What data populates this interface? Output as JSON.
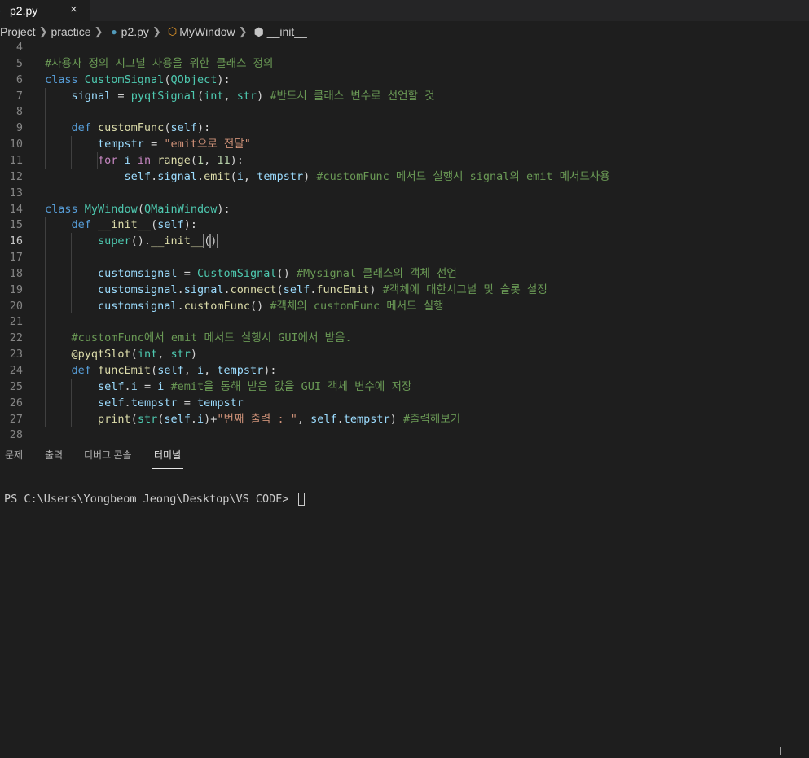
{
  "tab": {
    "filename": "p2.py",
    "close_glyph": "×"
  },
  "breadcrumb": {
    "project": "Project",
    "folder": "practice",
    "file": "p2.py",
    "class": "MyWindow",
    "method": "__init__"
  },
  "editor": {
    "active_line": "16",
    "lines": [
      {
        "n": "4",
        "tokens": []
      },
      {
        "n": "5",
        "tokens": [
          [
            "#사용자 정의 시그널 사용을 위한 클래스 정의",
            "cmt"
          ]
        ]
      },
      {
        "n": "6",
        "tokens": [
          [
            "class ",
            "kw"
          ],
          [
            "CustomSignal",
            "cls"
          ],
          [
            "(",
            "plain"
          ],
          [
            "QObject",
            "cls"
          ],
          [
            "):",
            "plain"
          ]
        ]
      },
      {
        "n": "7",
        "tokens": [
          [
            "    ",
            "plain"
          ],
          [
            "signal",
            "var"
          ],
          [
            " = ",
            "plain"
          ],
          [
            "pyqtSignal",
            "cls"
          ],
          [
            "(",
            "plain"
          ],
          [
            "int",
            "cls"
          ],
          [
            ", ",
            "plain"
          ],
          [
            "str",
            "cls"
          ],
          [
            ") ",
            "plain"
          ],
          [
            "#반드시 클래스 변수로 선언할 것",
            "cmt"
          ]
        ]
      },
      {
        "n": "8",
        "tokens": []
      },
      {
        "n": "9",
        "tokens": [
          [
            "    ",
            "plain"
          ],
          [
            "def ",
            "kw"
          ],
          [
            "customFunc",
            "fn"
          ],
          [
            "(",
            "plain"
          ],
          [
            "self",
            "var"
          ],
          [
            "):",
            "plain"
          ]
        ]
      },
      {
        "n": "10",
        "tokens": [
          [
            "        ",
            "plain"
          ],
          [
            "tempstr",
            "var"
          ],
          [
            " = ",
            "plain"
          ],
          [
            "\"emit으로 전달\"",
            "str"
          ]
        ]
      },
      {
        "n": "11",
        "tokens": [
          [
            "        ",
            "plain"
          ],
          [
            "for ",
            "ctl"
          ],
          [
            "i",
            "var"
          ],
          [
            " in ",
            "ctl"
          ],
          [
            "range",
            "fn"
          ],
          [
            "(",
            "plain"
          ],
          [
            "1",
            "num"
          ],
          [
            ", ",
            "plain"
          ],
          [
            "11",
            "num"
          ],
          [
            "):",
            "plain"
          ]
        ]
      },
      {
        "n": "12",
        "tokens": [
          [
            "            ",
            "plain"
          ],
          [
            "self",
            "var"
          ],
          [
            ".",
            "plain"
          ],
          [
            "signal",
            "var"
          ],
          [
            ".",
            "plain"
          ],
          [
            "emit",
            "fn"
          ],
          [
            "(",
            "plain"
          ],
          [
            "i",
            "var"
          ],
          [
            ", ",
            "plain"
          ],
          [
            "tempstr",
            "var"
          ],
          [
            ") ",
            "plain"
          ],
          [
            "#customFunc 메서드 실행시 signal의 emit 메서드사용",
            "cmt"
          ]
        ]
      },
      {
        "n": "13",
        "tokens": []
      },
      {
        "n": "14",
        "tokens": [
          [
            "class ",
            "kw"
          ],
          [
            "MyWindow",
            "cls"
          ],
          [
            "(",
            "plain"
          ],
          [
            "QMainWindow",
            "cls"
          ],
          [
            "):",
            "plain"
          ]
        ]
      },
      {
        "n": "15",
        "tokens": [
          [
            "    ",
            "plain"
          ],
          [
            "def ",
            "kw"
          ],
          [
            "__init__",
            "fn"
          ],
          [
            "(",
            "plain"
          ],
          [
            "self",
            "var"
          ],
          [
            "):",
            "plain"
          ]
        ]
      },
      {
        "n": "16",
        "tokens": [
          [
            "        ",
            "plain"
          ],
          [
            "super",
            "cls"
          ],
          [
            "().",
            "plain"
          ],
          [
            "__init__",
            "fn"
          ],
          [
            "(",
            "brk"
          ],
          [
            ")",
            "brk"
          ]
        ]
      },
      {
        "n": "17",
        "tokens": []
      },
      {
        "n": "18",
        "tokens": [
          [
            "        ",
            "plain"
          ],
          [
            "customsignal",
            "var"
          ],
          [
            " = ",
            "plain"
          ],
          [
            "CustomSignal",
            "cls"
          ],
          [
            "() ",
            "plain"
          ],
          [
            "#Mysignal 클래스의 객체 선언",
            "cmt"
          ]
        ]
      },
      {
        "n": "19",
        "tokens": [
          [
            "        ",
            "plain"
          ],
          [
            "customsignal",
            "var"
          ],
          [
            ".",
            "plain"
          ],
          [
            "signal",
            "var"
          ],
          [
            ".",
            "plain"
          ],
          [
            "connect",
            "fn"
          ],
          [
            "(",
            "plain"
          ],
          [
            "self",
            "var"
          ],
          [
            ".",
            "plain"
          ],
          [
            "funcEmit",
            "fn"
          ],
          [
            ") ",
            "plain"
          ],
          [
            "#객체에 대한시그널 및 슬롯 설정",
            "cmt"
          ]
        ]
      },
      {
        "n": "20",
        "tokens": [
          [
            "        ",
            "plain"
          ],
          [
            "customsignal",
            "var"
          ],
          [
            ".",
            "plain"
          ],
          [
            "customFunc",
            "fn"
          ],
          [
            "() ",
            "plain"
          ],
          [
            "#객체의 customFunc 메서드 실행",
            "cmt"
          ]
        ]
      },
      {
        "n": "21",
        "tokens": []
      },
      {
        "n": "22",
        "tokens": [
          [
            "    ",
            "plain"
          ],
          [
            "#customFunc에서 emit 메서드 실행시 GUI에서 받음.",
            "cmt"
          ]
        ]
      },
      {
        "n": "23",
        "tokens": [
          [
            "    ",
            "plain"
          ],
          [
            "@pyqtSlot",
            "fn"
          ],
          [
            "(",
            "plain"
          ],
          [
            "int",
            "cls"
          ],
          [
            ", ",
            "plain"
          ],
          [
            "str",
            "cls"
          ],
          [
            ")",
            "plain"
          ]
        ]
      },
      {
        "n": "24",
        "tokens": [
          [
            "    ",
            "plain"
          ],
          [
            "def ",
            "kw"
          ],
          [
            "funcEmit",
            "fn"
          ],
          [
            "(",
            "plain"
          ],
          [
            "self",
            "var"
          ],
          [
            ", ",
            "plain"
          ],
          [
            "i",
            "var"
          ],
          [
            ", ",
            "plain"
          ],
          [
            "tempstr",
            "var"
          ],
          [
            "):",
            "plain"
          ]
        ]
      },
      {
        "n": "25",
        "tokens": [
          [
            "        ",
            "plain"
          ],
          [
            "self",
            "var"
          ],
          [
            ".",
            "plain"
          ],
          [
            "i",
            "var"
          ],
          [
            " = ",
            "plain"
          ],
          [
            "i",
            "var"
          ],
          [
            " ",
            "plain"
          ],
          [
            "#emit을 통해 받은 값을 GUI 객체 변수에 저장",
            "cmt"
          ]
        ]
      },
      {
        "n": "26",
        "tokens": [
          [
            "        ",
            "plain"
          ],
          [
            "self",
            "var"
          ],
          [
            ".",
            "plain"
          ],
          [
            "tempstr",
            "var"
          ],
          [
            " = ",
            "plain"
          ],
          [
            "tempstr",
            "var"
          ]
        ]
      },
      {
        "n": "27",
        "tokens": [
          [
            "        ",
            "plain"
          ],
          [
            "print",
            "fn"
          ],
          [
            "(",
            "plain"
          ],
          [
            "str",
            "cls"
          ],
          [
            "(",
            "plain"
          ],
          [
            "self",
            "var"
          ],
          [
            ".",
            "plain"
          ],
          [
            "i",
            "var"
          ],
          [
            ")+",
            "plain"
          ],
          [
            "\"번째 출력 : \"",
            "str"
          ],
          [
            ", ",
            "plain"
          ],
          [
            "self",
            "var"
          ],
          [
            ".",
            "plain"
          ],
          [
            "tempstr",
            "var"
          ],
          [
            ") ",
            "plain"
          ],
          [
            "#출력해보기",
            "cmt"
          ]
        ]
      },
      {
        "n": "28",
        "tokens": []
      }
    ]
  },
  "panel": {
    "tabs": [
      "문제",
      "출력",
      "디버그 콘솔",
      "터미널"
    ],
    "active_tab": "터미널"
  },
  "terminal": {
    "prompt": "PS C:\\Users\\Yongbeom Jeong\\Desktop\\VS CODE> "
  },
  "colors": {
    "background": "#1e1e1e",
    "keyword": "#569cd6",
    "class": "#4ec9b0",
    "function": "#dcdcaa",
    "variable": "#9cdcfe",
    "string": "#ce9178",
    "comment": "#6a9955",
    "number": "#b5cea8"
  },
  "icons": [
    "python-file-icon",
    "close-icon",
    "chevron-right-icon",
    "class-symbol-icon",
    "method-symbol-icon",
    "text-cursor-icon"
  ]
}
